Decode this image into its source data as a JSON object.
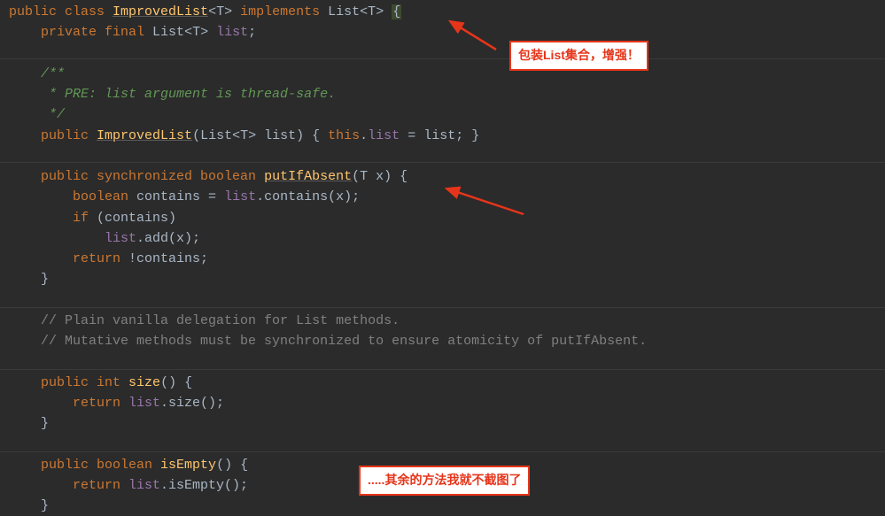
{
  "code": {
    "l1": {
      "t1": "public class ",
      "t2": "ImprovedList",
      "t3": "<",
      "t4": "T",
      "t5": "> ",
      "t6": "implements ",
      "t7": "List",
      "t8": "<",
      "t9": "T",
      "t10": "> ",
      "t11": "{"
    },
    "l2": {
      "t1": "private final ",
      "t2": "List",
      "t3": "<",
      "t4": "T",
      "t5": "> ",
      "t6": "list",
      "t7": ";"
    },
    "l3": "/**",
    "l4": " * PRE: list argument is thread-safe.",
    "l5": " */",
    "l6": {
      "t1": "public ",
      "t2": "ImprovedList",
      "t3": "(",
      "t4": "List",
      "t5": "<",
      "t6": "T",
      "t7": "> list) { ",
      "t8": "this",
      "t9": ".",
      "t10": "list",
      "t11": " = list; }"
    },
    "l7": {
      "t1": "public synchronized boolean ",
      "t2": "putIfAbsent",
      "t3": "(",
      "t4": "T",
      "t5": " x) {"
    },
    "l8": {
      "t1": "boolean ",
      "t2": "contains = ",
      "t3": "list",
      "t4": ".contains(x);"
    },
    "l9": {
      "t1": "if ",
      "t2": "(contains)"
    },
    "l10": {
      "t1": "list",
      "t2": ".add(x);"
    },
    "l11": {
      "t1": "return ",
      "t2": "!contains;"
    },
    "l12": "}",
    "l13": "// Plain vanilla delegation for List methods.",
    "l14": "// Mutative methods must be synchronized to ensure atomicity of putIfAbsent.",
    "l15": {
      "t1": "public int ",
      "t2": "size",
      "t3": "() {"
    },
    "l16": {
      "t1": "return ",
      "t2": "list",
      "t3": ".size();"
    },
    "l17": "}",
    "l18": {
      "t1": "public boolean ",
      "t2": "isEmpty",
      "t3": "() {"
    },
    "l19": {
      "t1": "return ",
      "t2": "list",
      "t3": ".isEmpty();"
    },
    "l20": "}"
  },
  "callouts": {
    "a": "包装List集合，增强！",
    "b": ".....其余的方法我就不截图了"
  },
  "colors": {
    "bg": "#2b2b2b",
    "kw": "#cc7832",
    "cls": "#ffc66d",
    "cmt": "#629755",
    "pcmt": "#808080",
    "field": "#9876aa",
    "txt": "#a9b7c6",
    "callout": "#e6351a"
  }
}
